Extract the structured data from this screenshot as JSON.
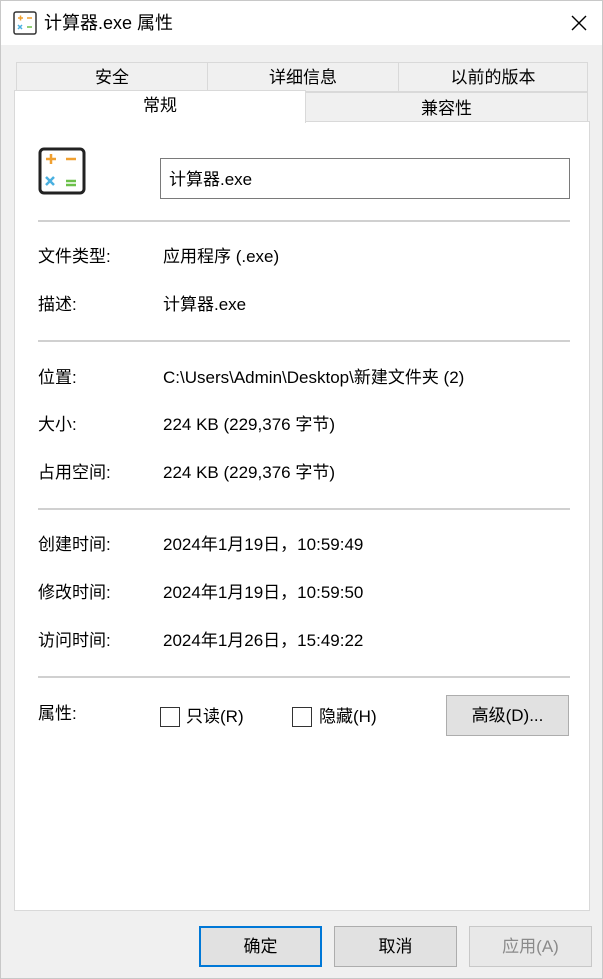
{
  "window": {
    "title": "计算器.exe 属性"
  },
  "tabs": {
    "back": [
      "安全",
      "详细信息",
      "以前的版本"
    ],
    "front": [
      "常规",
      "兼容性"
    ],
    "active": "常规"
  },
  "general": {
    "file_name": "计算器.exe",
    "rows_group1": [
      {
        "label": "文件类型:",
        "value": "应用程序 (.exe)"
      },
      {
        "label": "描述:",
        "value": "计算器.exe"
      }
    ],
    "rows_group2": [
      {
        "label": "位置:",
        "value": "C:\\Users\\Admin\\Desktop\\新建文件夹 (2)"
      },
      {
        "label": "大小:",
        "value": "224 KB (229,376 字节)"
      },
      {
        "label": "占用空间:",
        "value": "224 KB (229,376 字节)"
      }
    ],
    "rows_group3": [
      {
        "label": "创建时间:",
        "value": "2024年1月19日，10:59:49"
      },
      {
        "label": "修改时间:",
        "value": "2024年1月19日，10:59:50"
      },
      {
        "label": "访问时间:",
        "value": "2024年1月26日，15:49:22"
      }
    ],
    "attributes": {
      "label": "属性:",
      "readonly_label": "只读(R)",
      "readonly_checked": false,
      "hidden_label": "隐藏(H)",
      "hidden_checked": false,
      "advanced_label": "高级(D)..."
    }
  },
  "footer": {
    "ok_label": "确定",
    "cancel_label": "取消",
    "apply_label": "应用(A)"
  }
}
